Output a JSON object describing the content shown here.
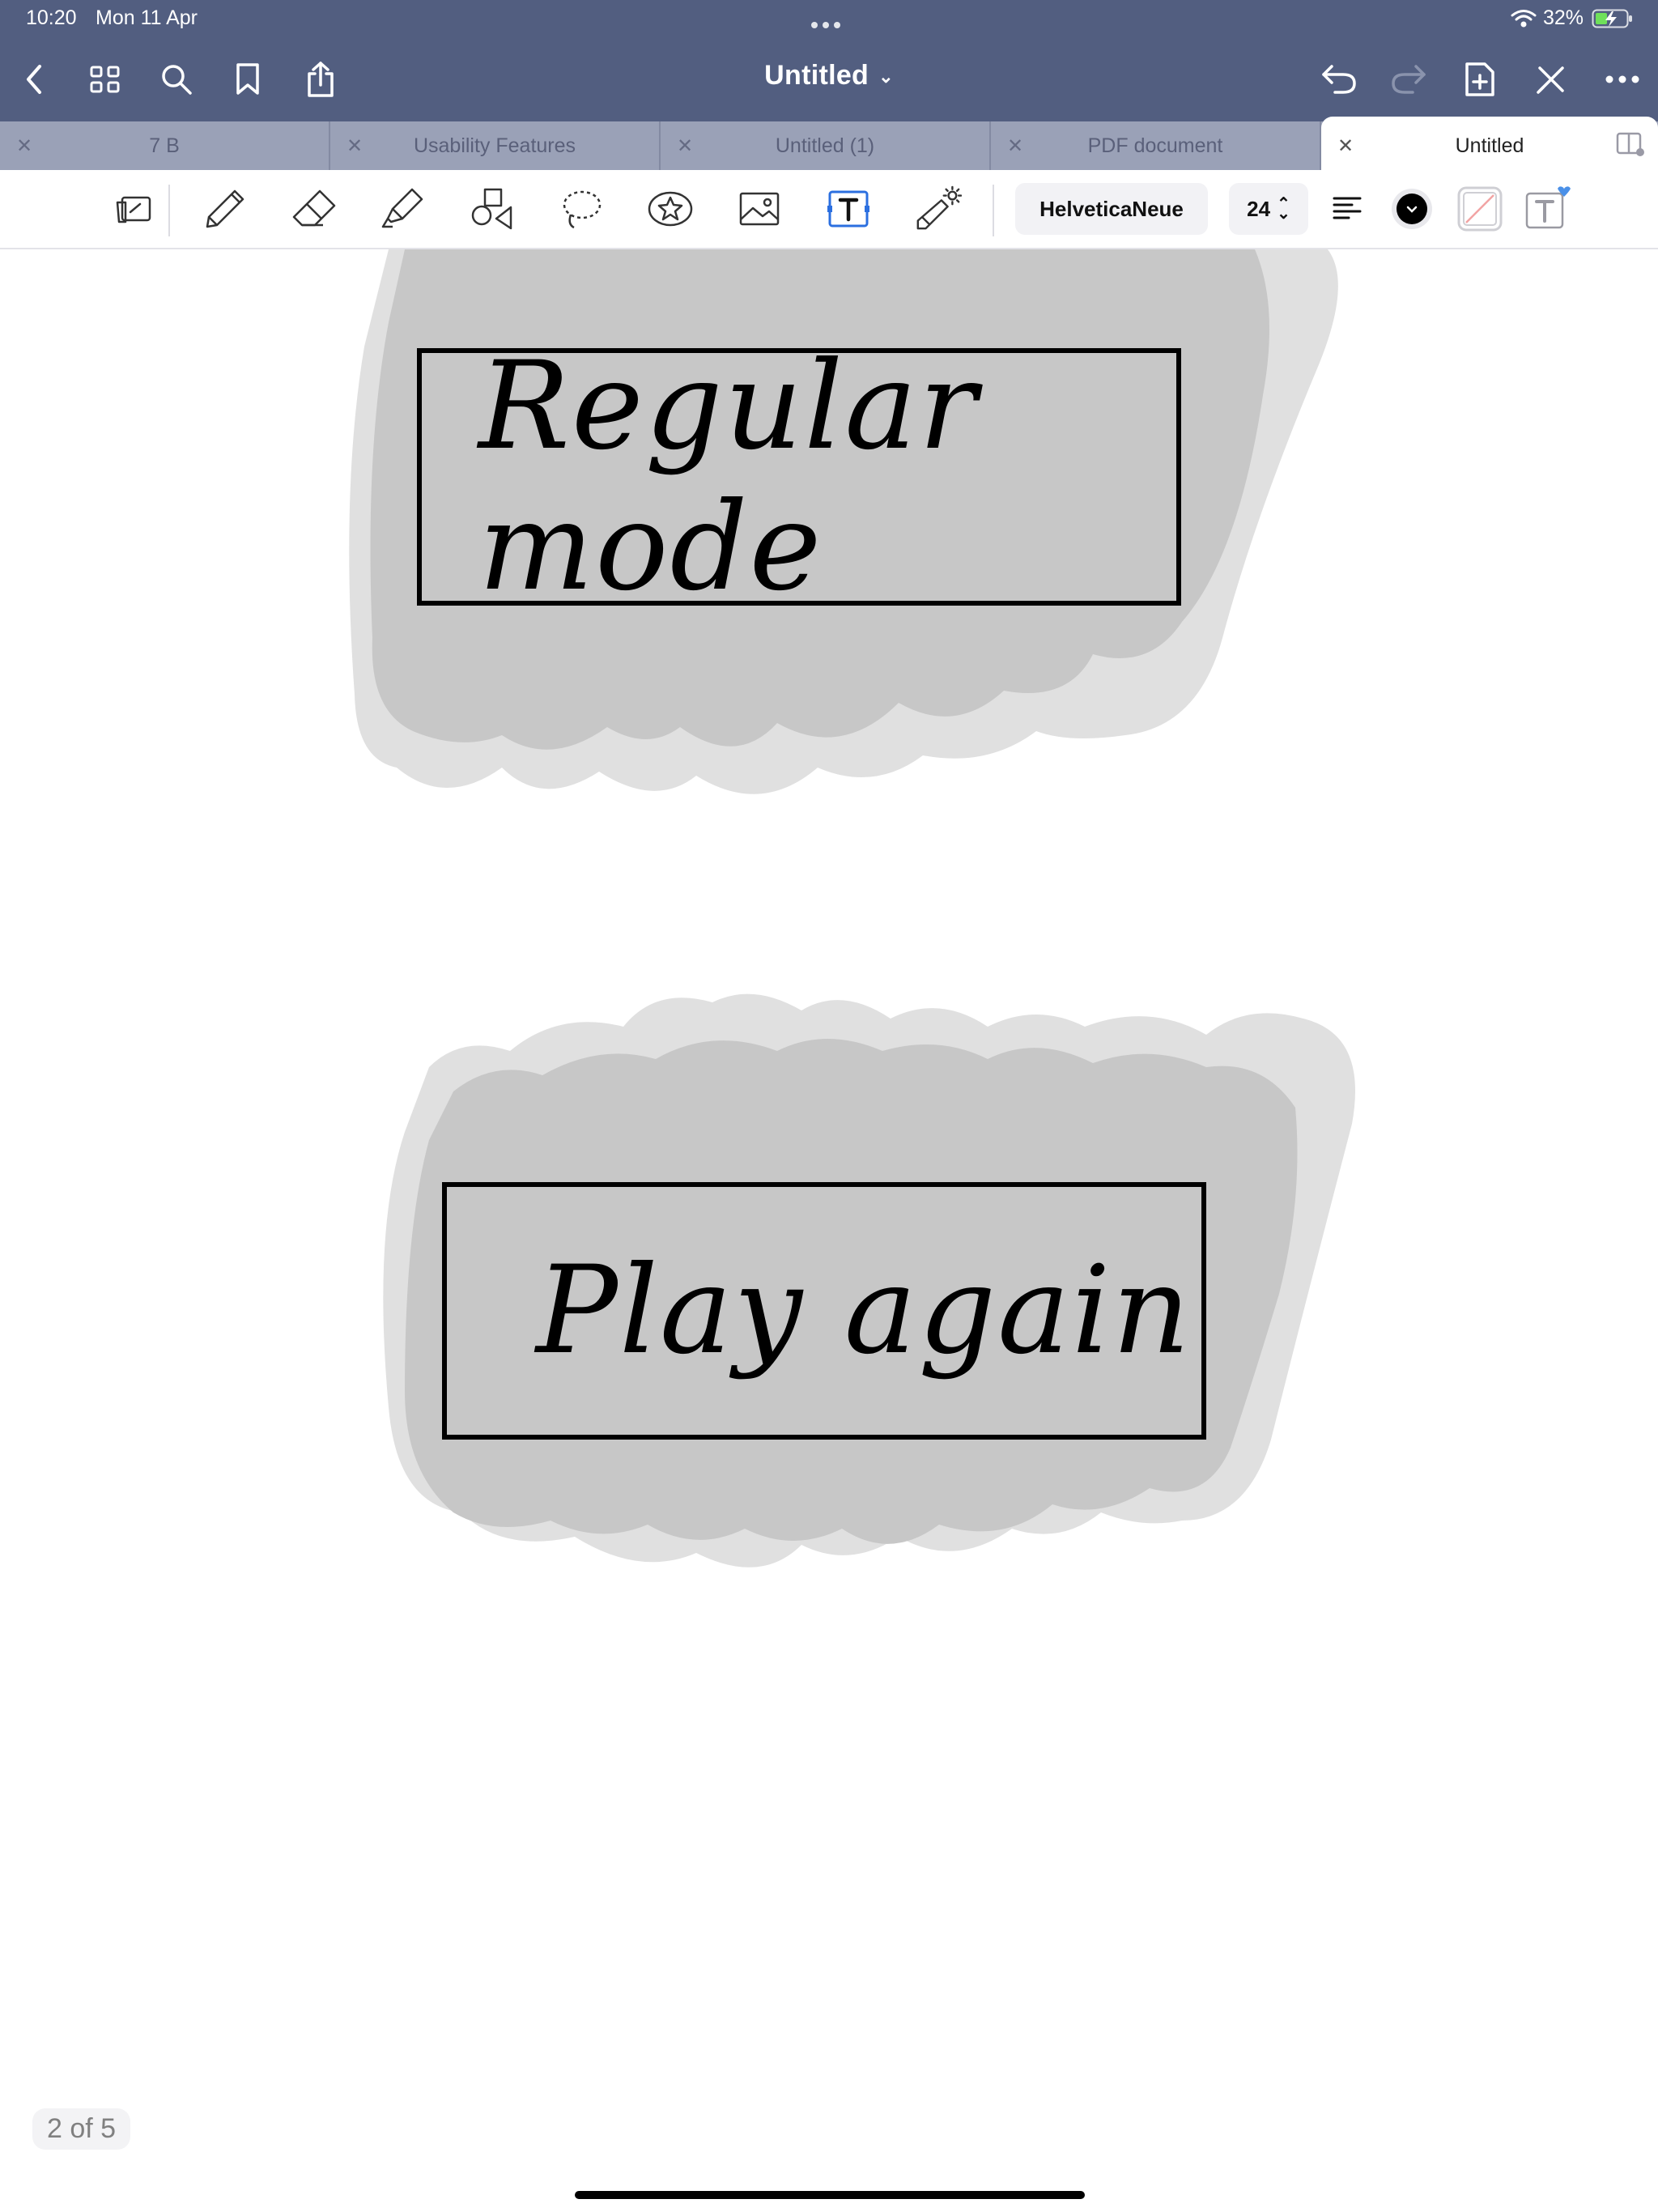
{
  "status": {
    "time": "10:20",
    "date": "Mon 11 Apr",
    "battery": "32%",
    "icons": [
      "wifi-icon",
      "battery-charging-icon"
    ]
  },
  "nav": {
    "title": "Untitled",
    "icons": [
      "back-chevron-icon",
      "thumbnails-grid-icon",
      "search-icon",
      "bookmark-icon",
      "share-icon",
      "undo-icon",
      "redo-icon",
      "add-page-icon",
      "pen-off-icon",
      "more-icon"
    ]
  },
  "tabs": [
    {
      "label": "7 B"
    },
    {
      "label": "Usability Features"
    },
    {
      "label": "Untitled (1)"
    },
    {
      "label": "PDF document"
    },
    {
      "label": "Untitled",
      "active": true
    }
  ],
  "toolbar": {
    "font_name": "HelveticaNeue",
    "font_size": "24",
    "active_tool": "text-tool",
    "text_color": "#000000"
  },
  "canvas": {
    "box1_text": "Regular mode",
    "box2_text": "Play again"
  },
  "page_indicator": "2 of 5",
  "colors": {
    "nav_bg": "#525e80",
    "tab_strip_bg": "#9aa1b7",
    "cloud_dark": "#c7c7c7",
    "cloud_light": "#e0e0e0",
    "accent": "#2b6fe0"
  }
}
